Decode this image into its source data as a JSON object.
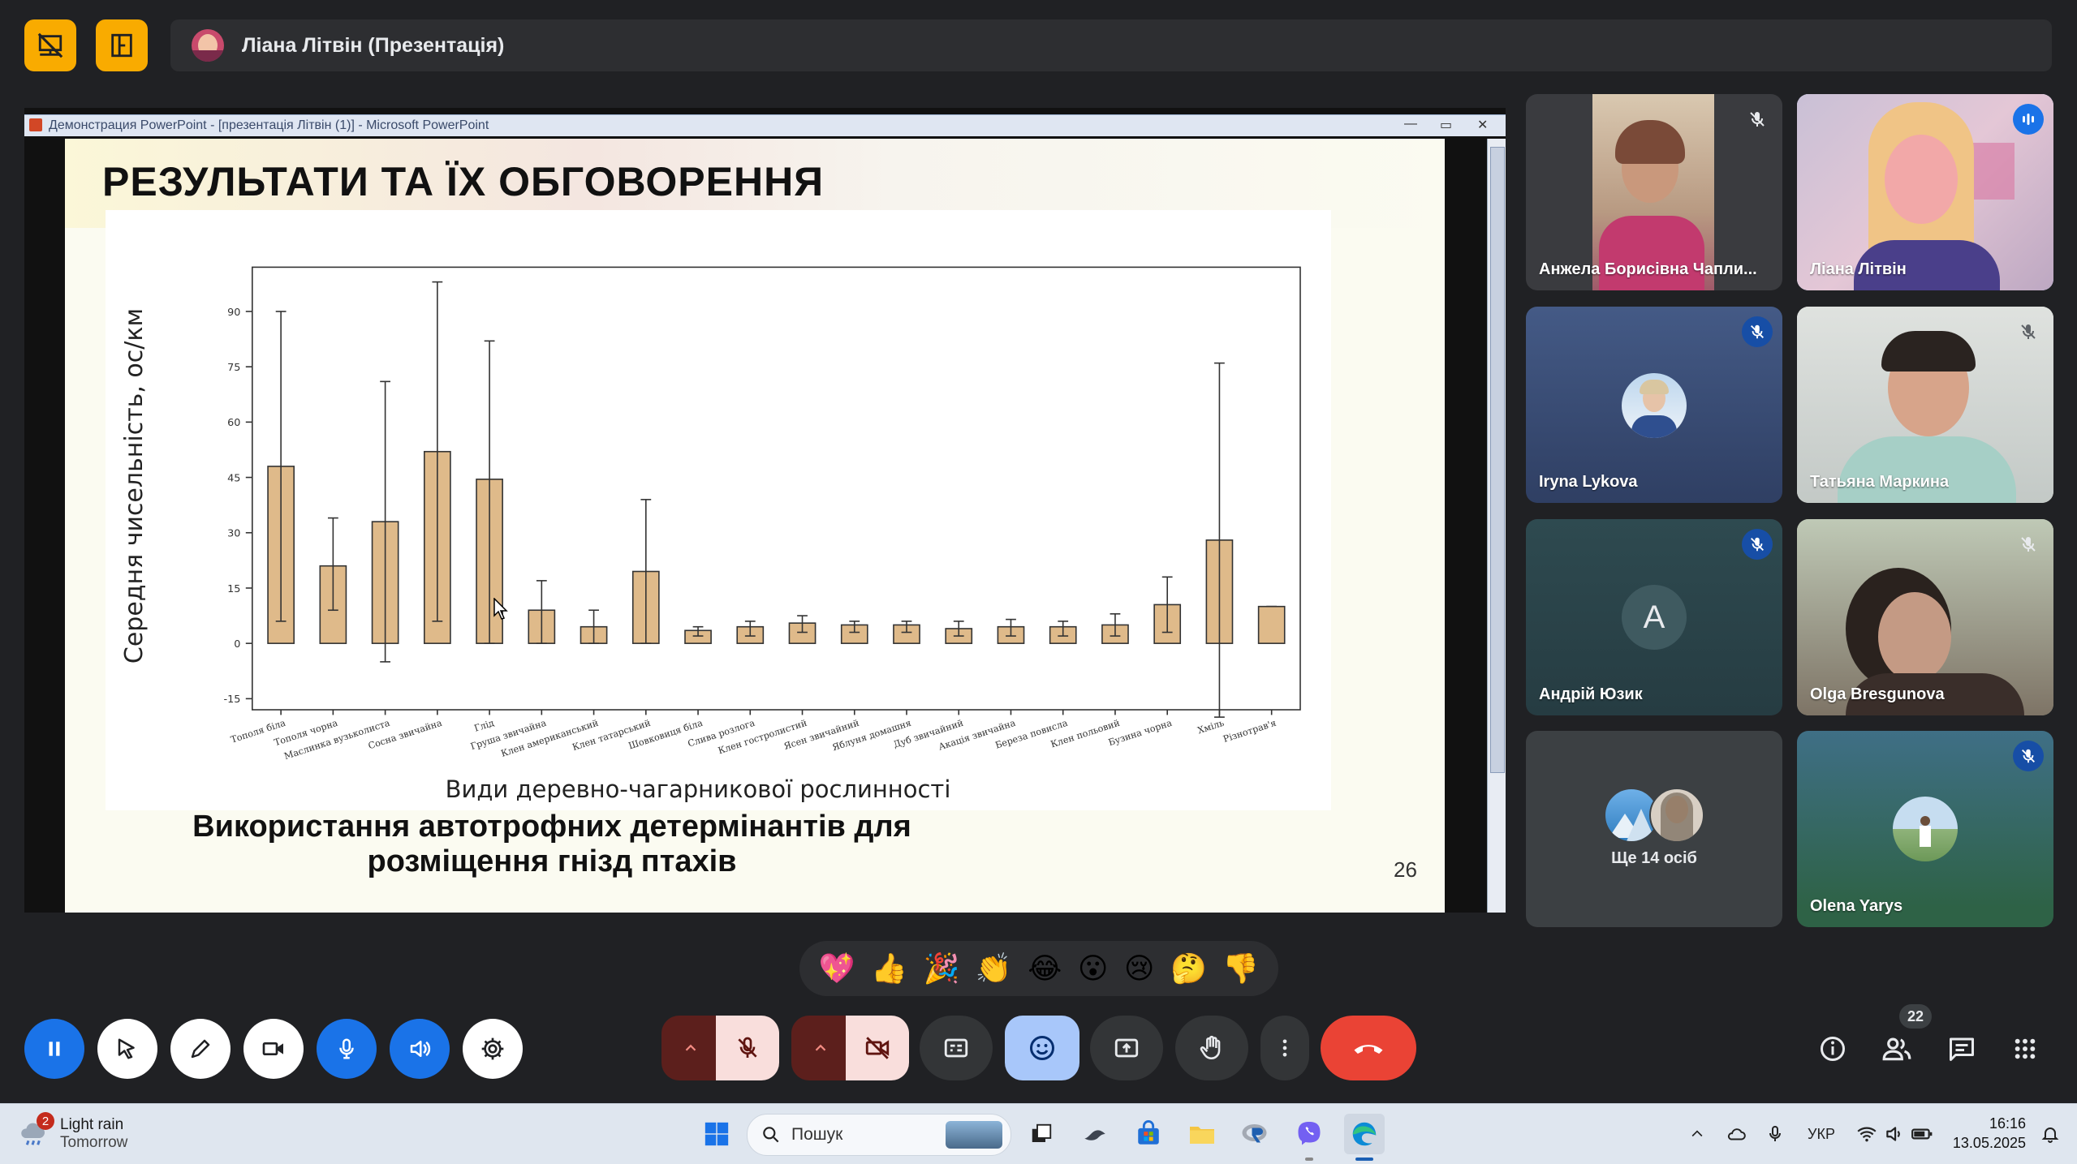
{
  "header": {
    "presenter_title": "Ліана Літвін (Презентація)"
  },
  "shared_window": {
    "title": "Демонстрация PowerPoint - [презентація Літвін (1)] - Microsoft PowerPoint",
    "min_glyph": "—",
    "max_glyph": "▭",
    "close_glyph": "✕"
  },
  "slide": {
    "title": "РЕЗУЛЬТАТИ ТА ЇХ ОБГОВОРЕННЯ",
    "subtitle": "Використання автотрофних детермінантів для розміщення гнізд птахів",
    "page_number": "26"
  },
  "chart_data": {
    "type": "bar",
    "xlabel": "Види деревно-чагарникової рослинності",
    "ylabel": "Середня чисельність, ос/км",
    "ylim": [
      -18,
      102
    ],
    "yticks": [
      -15,
      0,
      15,
      30,
      45,
      60,
      75,
      90
    ],
    "grid": false,
    "categories": [
      "Тополя біла",
      "Тополя чорна",
      "Маслинка вузьколиста",
      "Сосна звичайна",
      "Глід",
      "Груша звичайна",
      "Клен американський",
      "Клен татарський",
      "Шовковиця біла",
      "Слива розлога",
      "Клен гостролистий",
      "Ясен звичайний",
      "Яблуня домашня",
      "Дуб звичайний",
      "Акація звичайна",
      "Береза повисла",
      "Клен польовий",
      "Бузина чорна",
      "Хміль",
      "Різнотрав'я"
    ],
    "values": [
      48,
      21,
      33,
      52,
      44.5,
      9,
      4.5,
      19.5,
      3.5,
      4.5,
      5.5,
      5,
      5,
      4,
      4.5,
      4.5,
      5,
      10.5,
      28,
      10
    ],
    "err_low": [
      6,
      9,
      -5,
      6,
      0,
      0,
      0,
      0,
      2,
      2,
      3,
      3,
      3,
      2,
      2,
      2,
      2,
      3,
      -20,
      10
    ],
    "err_high": [
      90,
      34,
      71,
      98,
      82,
      17,
      9,
      39,
      4.5,
      6,
      7.5,
      6,
      6,
      6,
      6.5,
      6,
      8,
      18,
      76,
      10
    ]
  },
  "participants": [
    {
      "name": "Анжела Борисівна Чапли...",
      "muted": true,
      "video": true
    },
    {
      "name": "Ліана Літвін",
      "muted": false,
      "speaking": true,
      "video": true
    },
    {
      "name": "Iryna Lykova",
      "muted": true,
      "video": false
    },
    {
      "name": "Татьяна Маркина",
      "muted": true,
      "video": true
    },
    {
      "name": "Андрій Юзик",
      "initial": "A",
      "muted": true,
      "video": false
    },
    {
      "name": "Olga Bresgunova",
      "muted": true,
      "video": true
    },
    {
      "name": "Olena Yarys",
      "muted": true,
      "video": false
    }
  ],
  "more_people": "Ще 14 осіб",
  "reactions": [
    "💖",
    "👍",
    "🎉",
    "👏",
    "😂",
    "😮",
    "😢",
    "🤔",
    "👎"
  ],
  "people_count": "22",
  "taskbar": {
    "weather_badge": "2",
    "weather_title": "Light rain",
    "weather_sub": "Tomorrow",
    "search_placeholder": "Пошук",
    "language": "УКР",
    "time": "16:16",
    "date": "13.05.2025"
  },
  "colors": {
    "accent_yellow": "#f9ab00",
    "end_call": "#ea4335",
    "mic_blue": "#1a73e8",
    "bar_fill": "#dfba8a",
    "active_pill": "#a8c7fa"
  }
}
